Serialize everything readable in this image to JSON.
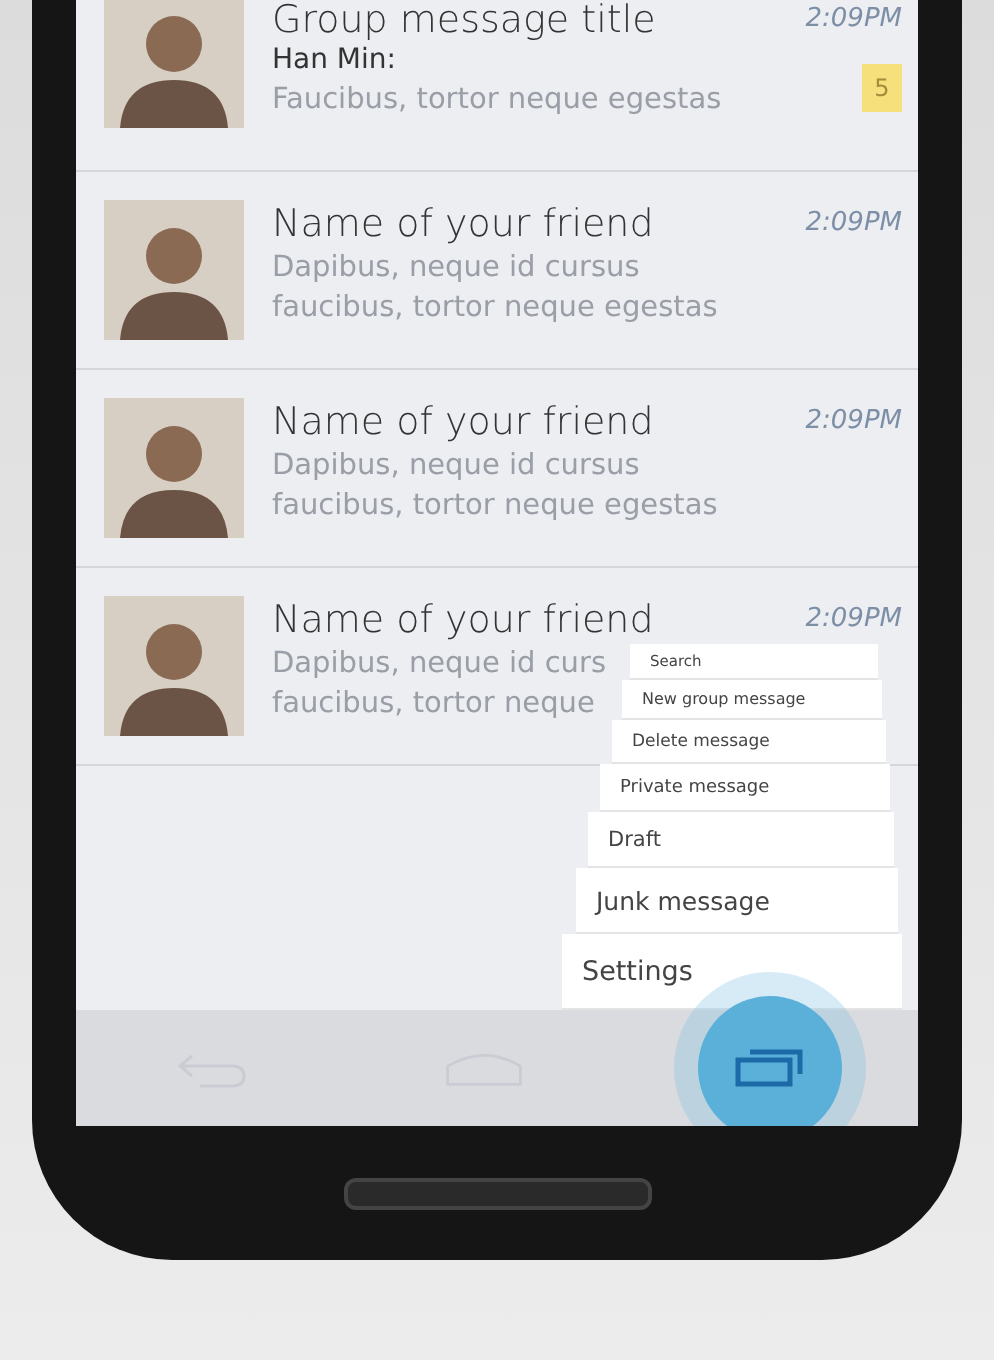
{
  "conversations": [
    {
      "title": "Group message title",
      "sender": "Han Min:",
      "preview_lines": [
        "Faucibus, tortor neque egestas"
      ],
      "time": "2:09PM",
      "unread": "5"
    },
    {
      "title": "Name of your friend",
      "preview_lines": [
        "Dapibus, neque id cursus",
        "faucibus, tortor neque egestas"
      ],
      "time": "2:09PM"
    },
    {
      "title": "Name of your friend",
      "preview_lines": [
        "Dapibus, neque id cursus",
        "faucibus, tortor neque egestas"
      ],
      "time": "2:09PM"
    },
    {
      "title": "Name of your friend",
      "preview_lines": [
        "Dapibus, neque id curs",
        "faucibus, tortor neque"
      ],
      "time": "2:09PM"
    }
  ],
  "menu": {
    "items": [
      "Search",
      "New  group message",
      "Delete message",
      "Private message",
      "Draft",
      "Junk message",
      "Settings"
    ]
  },
  "nav_buttons": [
    {
      "kind": "back",
      "selected": false
    },
    {
      "kind": "home",
      "selected": false
    },
    {
      "kind": "recents",
      "selected": true
    }
  ]
}
